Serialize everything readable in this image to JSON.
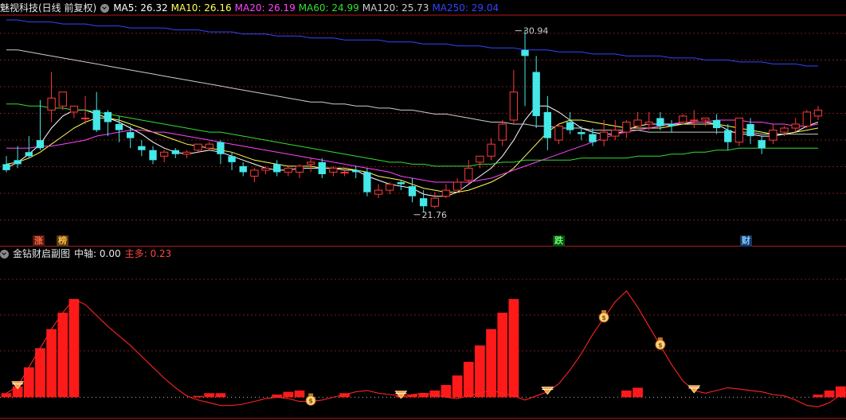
{
  "main_panel": {
    "title": "魅视科技(日线 前复权)",
    "ma_labels": [
      {
        "text": "MA5: 26.32",
        "color": "#ffffff"
      },
      {
        "text": "MA10: 26.16",
        "color": "#ffff55"
      },
      {
        "text": "MA20: 26.19",
        "color": "#ff44ff"
      },
      {
        "text": "MA60: 24.99",
        "color": "#33dd33"
      },
      {
        "text": "MA120: 25.73",
        "color": "#cccccc"
      },
      {
        "text": "MA250: 29.04",
        "color": "#3344ff"
      }
    ],
    "max_label": "30.94",
    "min_label": "21.76",
    "tags": [
      {
        "text": "涨",
        "bg": "#5a1a14",
        "color": "#ff6644"
      },
      {
        "text": "榜",
        "bg": "#5a3a10",
        "color": "#ffbb44"
      },
      {
        "text": "跌",
        "bg": "#0e4a14",
        "color": "#66ff66"
      },
      {
        "text": "财",
        "bg": "#143a66",
        "color": "#88ccff"
      }
    ]
  },
  "sub_panel": {
    "title": "金钻财启副图",
    "axis_label": "中轴: 0.00",
    "main_label": "主多: 0.23"
  },
  "colors": {
    "up": "#ff3a3a",
    "down": "#44e8e8",
    "grid": "#7a1a1a",
    "border": "#b01a1a"
  },
  "chart_data": [
    {
      "type": "candlestick",
      "title": "魅视科技(日线 前复权)",
      "ylim": [
        20.8,
        31.6
      ],
      "annotations": [
        {
          "text": "30.94",
          "index": 45,
          "value": 30.94
        },
        {
          "text": "21.76",
          "index": 36,
          "value": 21.76
        }
      ],
      "ohlc": [
        [
          24.2,
          24.6,
          23.9,
          23.8
        ],
        [
          24.4,
          25.1,
          24.2,
          24.0
        ],
        [
          24.8,
          25.6,
          24.6,
          24.5
        ],
        [
          25.4,
          27.4,
          25.0,
          24.9
        ],
        [
          26.9,
          28.8,
          27.5,
          26.3
        ],
        [
          27.1,
          27.7,
          27.8,
          26.9
        ],
        [
          26.8,
          27.1,
          27.1,
          26.5
        ],
        [
          26.5,
          27.6,
          26.5,
          26.2
        ],
        [
          26.9,
          27.8,
          25.9,
          25.8
        ],
        [
          26.8,
          26.9,
          26.3,
          25.6
        ],
        [
          26.2,
          26.6,
          25.9,
          25.3
        ],
        [
          25.8,
          26.1,
          25.5,
          25.0
        ],
        [
          25.1,
          25.4,
          24.9,
          24.6
        ],
        [
          24.9,
          25.1,
          24.4,
          24.2
        ],
        [
          24.6,
          24.9,
          24.8,
          24.3
        ],
        [
          24.9,
          25.0,
          24.7,
          24.5
        ],
        [
          24.7,
          24.9,
          24.8,
          24.5
        ],
        [
          24.9,
          25.1,
          25.2,
          24.8
        ],
        [
          25.0,
          25.3,
          25.2,
          24.9
        ],
        [
          25.3,
          25.4,
          24.7,
          24.2
        ],
        [
          24.6,
          24.8,
          24.3,
          23.9
        ],
        [
          24.1,
          24.3,
          23.8,
          23.6
        ],
        [
          23.6,
          24.0,
          23.9,
          23.3
        ],
        [
          23.9,
          24.1,
          24.0,
          23.7
        ],
        [
          24.2,
          24.4,
          23.8,
          23.6
        ],
        [
          23.8,
          24.1,
          24.0,
          23.6
        ],
        [
          23.8,
          24.2,
          24.1,
          23.5
        ],
        [
          24.2,
          24.5,
          24.3,
          23.8
        ],
        [
          24.3,
          24.5,
          23.7,
          23.5
        ],
        [
          23.8,
          24.1,
          24.0,
          23.6
        ],
        [
          23.8,
          24.0,
          23.8,
          23.6
        ],
        [
          23.9,
          24.1,
          23.8,
          23.5
        ],
        [
          23.8,
          24.0,
          22.8,
          22.6
        ],
        [
          22.7,
          23.2,
          22.9,
          22.5
        ],
        [
          22.9,
          23.3,
          23.2,
          22.7
        ],
        [
          23.3,
          23.4,
          23.2,
          22.9
        ],
        [
          23.1,
          23.5,
          22.6,
          22.3
        ],
        [
          22.5,
          22.9,
          22.1,
          21.8
        ],
        [
          22.1,
          22.8,
          22.5,
          22.0
        ],
        [
          22.6,
          23.2,
          22.9,
          22.5
        ],
        [
          22.9,
          23.5,
          23.3,
          22.9
        ],
        [
          23.4,
          24.4,
          24.0,
          23.2
        ],
        [
          24.3,
          24.5,
          24.6,
          24.0
        ],
        [
          24.6,
          25.5,
          25.2,
          24.4
        ],
        [
          25.4,
          26.4,
          26.2,
          25.1
        ],
        [
          26.4,
          28.9,
          27.8,
          26.2
        ],
        [
          29.9,
          30.9,
          29.6,
          27.1
        ],
        [
          28.8,
          29.6,
          26.6,
          26.0
        ],
        [
          26.8,
          27.6,
          25.5,
          24.9
        ],
        [
          25.4,
          26.2,
          26.1,
          25.2
        ],
        [
          26.3,
          26.8,
          25.9,
          25.7
        ],
        [
          25.8,
          26.1,
          25.7,
          25.4
        ],
        [
          25.7,
          26.0,
          25.3,
          25.1
        ],
        [
          25.4,
          26.4,
          25.8,
          25.1
        ],
        [
          25.6,
          26.4,
          25.9,
          25.4
        ],
        [
          25.8,
          26.4,
          26.3,
          25.5
        ],
        [
          26.1,
          26.8,
          26.4,
          26.0
        ],
        [
          26.2,
          26.8,
          26.3,
          25.9
        ],
        [
          26.5,
          26.8,
          26.1,
          25.9
        ],
        [
          26.2,
          26.4,
          26.1,
          25.8
        ],
        [
          26.3,
          26.7,
          26.6,
          26.2
        ],
        [
          26.4,
          26.9,
          26.4,
          26.0
        ],
        [
          26.4,
          26.5,
          26.5,
          26.1
        ],
        [
          26.4,
          26.7,
          26.0,
          25.7
        ],
        [
          25.9,
          26.2,
          25.3,
          24.9
        ],
        [
          25.3,
          26.3,
          26.5,
          25.1
        ],
        [
          26.2,
          26.5,
          25.6,
          25.2
        ],
        [
          25.4,
          25.6,
          25.0,
          24.7
        ],
        [
          25.4,
          26.2,
          25.9,
          25.2
        ],
        [
          25.8,
          26.1,
          26.0,
          25.6
        ],
        [
          26.0,
          26.5,
          26.2,
          25.8
        ],
        [
          26.1,
          26.9,
          26.8,
          26.0
        ],
        [
          26.6,
          27.1,
          26.9,
          26.4
        ]
      ],
      "ma": {
        "MA5": [
          24.0,
          24.3,
          24.7,
          25.2,
          26.0,
          26.6,
          26.9,
          26.9,
          26.7,
          26.5,
          26.3,
          26.0,
          25.7,
          25.3,
          25.0,
          24.8,
          24.7,
          24.8,
          24.9,
          24.8,
          24.6,
          24.4,
          24.2,
          24.0,
          23.9,
          23.9,
          24.0,
          24.0,
          24.0,
          24.0,
          23.9,
          23.9,
          23.6,
          23.4,
          23.2,
          23.1,
          23.0,
          22.7,
          22.6,
          22.6,
          22.8,
          23.2,
          23.6,
          24.0,
          24.6,
          25.4,
          26.4,
          27.1,
          27.1,
          26.8,
          26.4,
          26.0,
          25.8,
          25.7,
          25.7,
          25.9,
          26.1,
          26.2,
          26.2,
          26.2,
          26.2,
          26.3,
          26.3,
          26.2,
          25.9,
          25.7,
          25.7,
          25.6,
          25.6,
          25.7,
          25.8,
          26.1,
          26.3
        ],
        "MA10": [
          24.2,
          24.3,
          24.5,
          24.8,
          25.2,
          25.6,
          26.0,
          26.3,
          26.5,
          26.5,
          26.4,
          26.2,
          26.0,
          25.8,
          25.6,
          25.4,
          25.2,
          25.1,
          25.0,
          24.9,
          24.8,
          24.6,
          24.4,
          24.3,
          24.2,
          24.1,
          24.1,
          24.1,
          24.0,
          24.0,
          24.0,
          23.9,
          23.8,
          23.6,
          23.5,
          23.4,
          23.2,
          23.0,
          22.9,
          22.8,
          22.8,
          22.9,
          23.1,
          23.3,
          23.6,
          24.0,
          24.6,
          25.2,
          25.8,
          26.2,
          26.4,
          26.4,
          26.3,
          26.2,
          26.1,
          26.0,
          26.0,
          26.0,
          26.0,
          26.1,
          26.2,
          26.2,
          26.2,
          26.2,
          26.1,
          26.0,
          25.9,
          25.8,
          25.7,
          25.7,
          25.8,
          25.9,
          26.0
        ],
        "MA20": [
          25.0,
          25.0,
          25.0,
          25.1,
          25.1,
          25.2,
          25.3,
          25.4,
          25.6,
          25.7,
          25.8,
          25.9,
          25.9,
          25.8,
          25.8,
          25.7,
          25.6,
          25.5,
          25.4,
          25.3,
          25.2,
          25.1,
          25.0,
          24.9,
          24.8,
          24.7,
          24.6,
          24.5,
          24.4,
          24.3,
          24.2,
          24.1,
          24.0,
          23.9,
          23.8,
          23.6,
          23.5,
          23.4,
          23.3,
          23.3,
          23.3,
          23.3,
          23.4,
          23.5,
          23.7,
          23.9,
          24.1,
          24.3,
          24.5,
          24.7,
          24.9,
          25.1,
          25.3,
          25.5,
          25.7,
          25.8,
          25.9,
          26.0,
          26.1,
          26.2,
          26.3,
          26.3,
          26.3,
          26.4,
          26.4,
          26.4,
          26.3,
          26.3,
          26.2,
          26.2,
          26.1,
          26.1,
          26.2
        ],
        "MA60": [
          27.2,
          27.2,
          27.1,
          27.1,
          27.0,
          27.0,
          26.9,
          26.9,
          26.8,
          26.7,
          26.6,
          26.5,
          26.4,
          26.3,
          26.2,
          26.1,
          26.0,
          25.9,
          25.8,
          25.8,
          25.7,
          25.6,
          25.5,
          25.4,
          25.3,
          25.2,
          25.1,
          25.0,
          24.9,
          24.8,
          24.7,
          24.6,
          24.5,
          24.4,
          24.3,
          24.3,
          24.2,
          24.2,
          24.1,
          24.1,
          24.1,
          24.1,
          24.2,
          24.2,
          24.3,
          24.3,
          24.4,
          24.4,
          24.4,
          24.4,
          24.4,
          24.5,
          24.5,
          24.5,
          24.5,
          24.5,
          24.6,
          24.6,
          24.6,
          24.7,
          24.7,
          24.8,
          24.8,
          24.9,
          24.9,
          25.0,
          25.0,
          25.0,
          25.0,
          25.0,
          25.0,
          25.0,
          25.0
        ],
        "MA120": [
          29.9,
          29.9,
          29.8,
          29.7,
          29.6,
          29.5,
          29.4,
          29.3,
          29.2,
          29.1,
          29.0,
          28.9,
          28.8,
          28.7,
          28.6,
          28.5,
          28.4,
          28.3,
          28.2,
          28.1,
          28.0,
          27.9,
          27.8,
          27.7,
          27.6,
          27.5,
          27.4,
          27.3,
          27.3,
          27.2,
          27.2,
          27.1,
          27.1,
          27.0,
          27.0,
          26.9,
          26.9,
          26.8,
          26.7,
          26.7,
          26.6,
          26.5,
          26.4,
          26.3,
          26.3,
          26.2,
          26.2,
          26.1,
          26.1,
          26.0,
          26.0,
          26.0,
          25.9,
          25.9,
          25.9,
          25.9,
          25.9,
          25.8,
          25.8,
          25.8,
          25.8,
          25.8,
          25.8,
          25.8,
          25.8,
          25.8,
          25.8,
          25.7,
          25.7,
          25.7,
          25.7,
          25.7,
          25.7
        ],
        "MA250": [
          31.4,
          31.4,
          31.3,
          31.3,
          31.3,
          31.2,
          31.2,
          31.2,
          31.1,
          31.1,
          31.1,
          31.0,
          31.0,
          31.0,
          31.0,
          30.9,
          30.9,
          30.9,
          30.8,
          30.8,
          30.8,
          30.7,
          30.7,
          30.7,
          30.6,
          30.6,
          30.6,
          30.5,
          30.5,
          30.5,
          30.4,
          30.4,
          30.4,
          30.4,
          30.3,
          30.3,
          30.3,
          30.2,
          30.2,
          30.2,
          30.1,
          30.1,
          30.1,
          30.0,
          30.0,
          30.0,
          29.9,
          29.9,
          29.9,
          29.8,
          29.8,
          29.8,
          29.7,
          29.7,
          29.7,
          29.6,
          29.6,
          29.6,
          29.6,
          29.5,
          29.5,
          29.5,
          29.4,
          29.4,
          29.4,
          29.3,
          29.3,
          29.3,
          29.2,
          29.2,
          29.2,
          29.1,
          29.1
        ]
      }
    },
    {
      "type": "line",
      "title": "金钻财启副图",
      "ylim": [
        -0.12,
        1.0
      ],
      "line": [
        0.03,
        0.08,
        0.22,
        0.36,
        0.5,
        0.62,
        0.72,
        0.68,
        0.6,
        0.52,
        0.45,
        0.38,
        0.3,
        0.22,
        0.14,
        0.07,
        0.01,
        -0.02,
        -0.04,
        -0.06,
        -0.06,
        -0.05,
        -0.03,
        -0.01,
        0.0,
        -0.01,
        -0.03,
        -0.03,
        -0.02,
        0.0,
        0.02,
        0.04,
        0.05,
        0.03,
        0.02,
        0.01,
        0.02,
        0.03,
        0.02,
        0.0,
        -0.01,
        0.01,
        0.03,
        0.05,
        0.03,
        0.01,
        -0.02,
        0.01,
        0.04,
        0.1,
        0.2,
        0.32,
        0.46,
        0.58,
        0.7,
        0.78,
        0.66,
        0.52,
        0.38,
        0.24,
        0.12,
        0.05,
        0.03,
        0.05,
        0.07,
        0.06,
        0.05,
        0.04,
        0.02,
        0.01,
        -0.02,
        -0.06,
        -0.07,
        -0.04,
        0.02,
        0.05
      ],
      "bars": [
        0.03,
        0.08,
        0.22,
        0.36,
        0.5,
        0.62,
        0.72,
        0,
        0,
        0,
        0,
        0,
        0,
        0,
        0,
        0,
        0,
        0.01,
        0.03,
        0.03,
        0,
        0,
        0,
        0,
        0.02,
        0.04,
        0.05,
        0,
        0,
        0,
        0.03,
        0,
        0,
        0,
        0,
        0.01,
        0.02,
        0.03,
        0.05,
        0.09,
        0.16,
        0.26,
        0.38,
        0.5,
        0.62,
        0.72,
        0,
        0,
        0,
        0,
        0,
        0,
        0,
        0,
        0,
        0.05,
        0.07,
        0,
        0,
        0,
        0,
        0,
        0,
        0,
        0,
        0,
        0,
        0,
        0,
        0,
        0,
        0,
        0.02,
        0.05,
        0.08
      ],
      "markers": [
        {
          "index": 1,
          "icon": "diamond-icon"
        },
        {
          "index": 27,
          "icon": "money-bag-icon"
        },
        {
          "index": 35,
          "icon": "diamond-icon"
        },
        {
          "index": 48,
          "icon": "diamond-icon"
        },
        {
          "index": 53,
          "icon": "money-bag-icon"
        },
        {
          "index": 58,
          "icon": "money-bag-icon"
        },
        {
          "index": 61,
          "icon": "diamond-icon"
        }
      ]
    }
  ]
}
